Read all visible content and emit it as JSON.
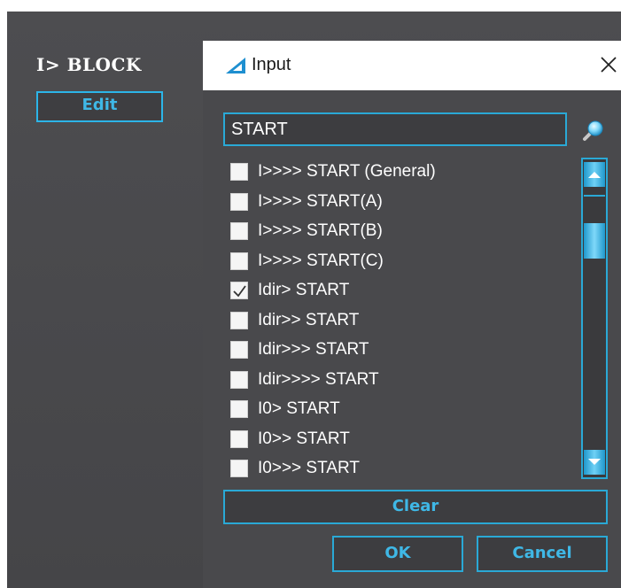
{
  "block": {
    "title": "I> BLOCK",
    "edit_label": "Edit"
  },
  "dialog": {
    "title": "Input",
    "close_glyph": "✕",
    "search_value": "START",
    "items": [
      {
        "label": "I>>>> START (General)",
        "checked": false
      },
      {
        "label": "I>>>> START(A)",
        "checked": false
      },
      {
        "label": "I>>>> START(B)",
        "checked": false
      },
      {
        "label": "I>>>> START(C)",
        "checked": false
      },
      {
        "label": "Idir> START",
        "checked": true
      },
      {
        "label": "Idir>> START",
        "checked": false
      },
      {
        "label": "Idir>>> START",
        "checked": false
      },
      {
        "label": "Idir>>>> START",
        "checked": false
      },
      {
        "label": "I0> START",
        "checked": false
      },
      {
        "label": "I0>> START",
        "checked": false
      },
      {
        "label": "I0>>> START",
        "checked": false
      }
    ],
    "clear_label": "Clear",
    "ok_label": "OK",
    "cancel_label": "Cancel"
  },
  "colors": {
    "accent": "#2aa9d6",
    "button_text": "#3fb8e6",
    "panel_bg": "#49494c"
  },
  "icons": {
    "title_icon": "triangle-ruler-icon",
    "search_icon": "magnifier-icon",
    "close_icon": "close-icon"
  }
}
